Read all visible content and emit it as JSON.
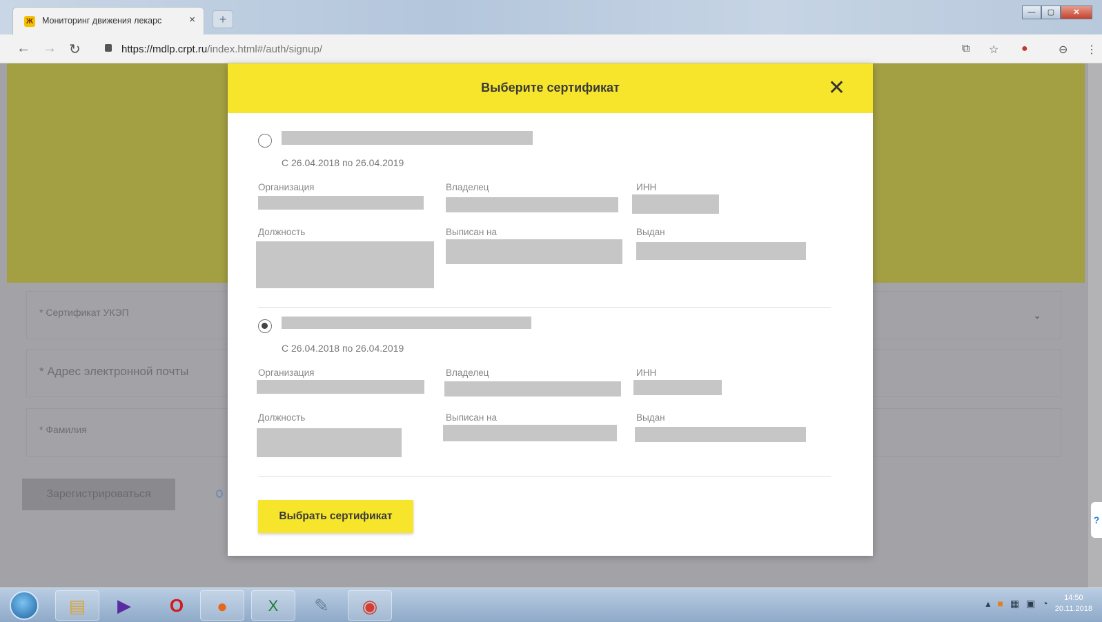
{
  "browser": {
    "tab_title": "Мониторинг движения лекарс",
    "tab_favicon": "Ж",
    "tab_close": "×",
    "new_tab": "+",
    "url_host": "https://mdlp.crpt.ru",
    "url_path": "/index.html#/auth/signup/",
    "window_controls": {
      "minimize": "—",
      "maximize": "▢",
      "close": "✕"
    }
  },
  "background_form": {
    "cert_label": "* Сертификат УКЭП",
    "email_label": "* Адрес электронной почты",
    "surname_label": "* Фамилия",
    "register_button": "Зарегистрироваться",
    "chevron": "⌄",
    "side_badge": "?"
  },
  "modal": {
    "title": "Выберите сертификат",
    "close": "✕",
    "select_button": "Выбрать сертификат",
    "certificates": [
      {
        "selected": false,
        "validity": "С 26.04.2018 по 26.04.2019",
        "labels": {
          "org": "Организация",
          "owner": "Владелец",
          "inn": "ИНН",
          "position": "Должность",
          "issued_to": "Выписан на",
          "issued_by": "Выдан"
        }
      },
      {
        "selected": true,
        "validity": "С 26.04.2018 по 26.04.2019",
        "labels": {
          "org": "Организация",
          "owner": "Владелец",
          "inn": "ИНН",
          "position": "Должность",
          "issued_to": "Выписан на",
          "issued_by": "Выдан"
        }
      }
    ]
  },
  "taskbar": {
    "time": "14:50",
    "date": "20.11.2018"
  },
  "colors": {
    "accent_yellow": "#f6e52b",
    "olive_band": "#a39f43",
    "overlay_gray": "#a3a2a6"
  }
}
